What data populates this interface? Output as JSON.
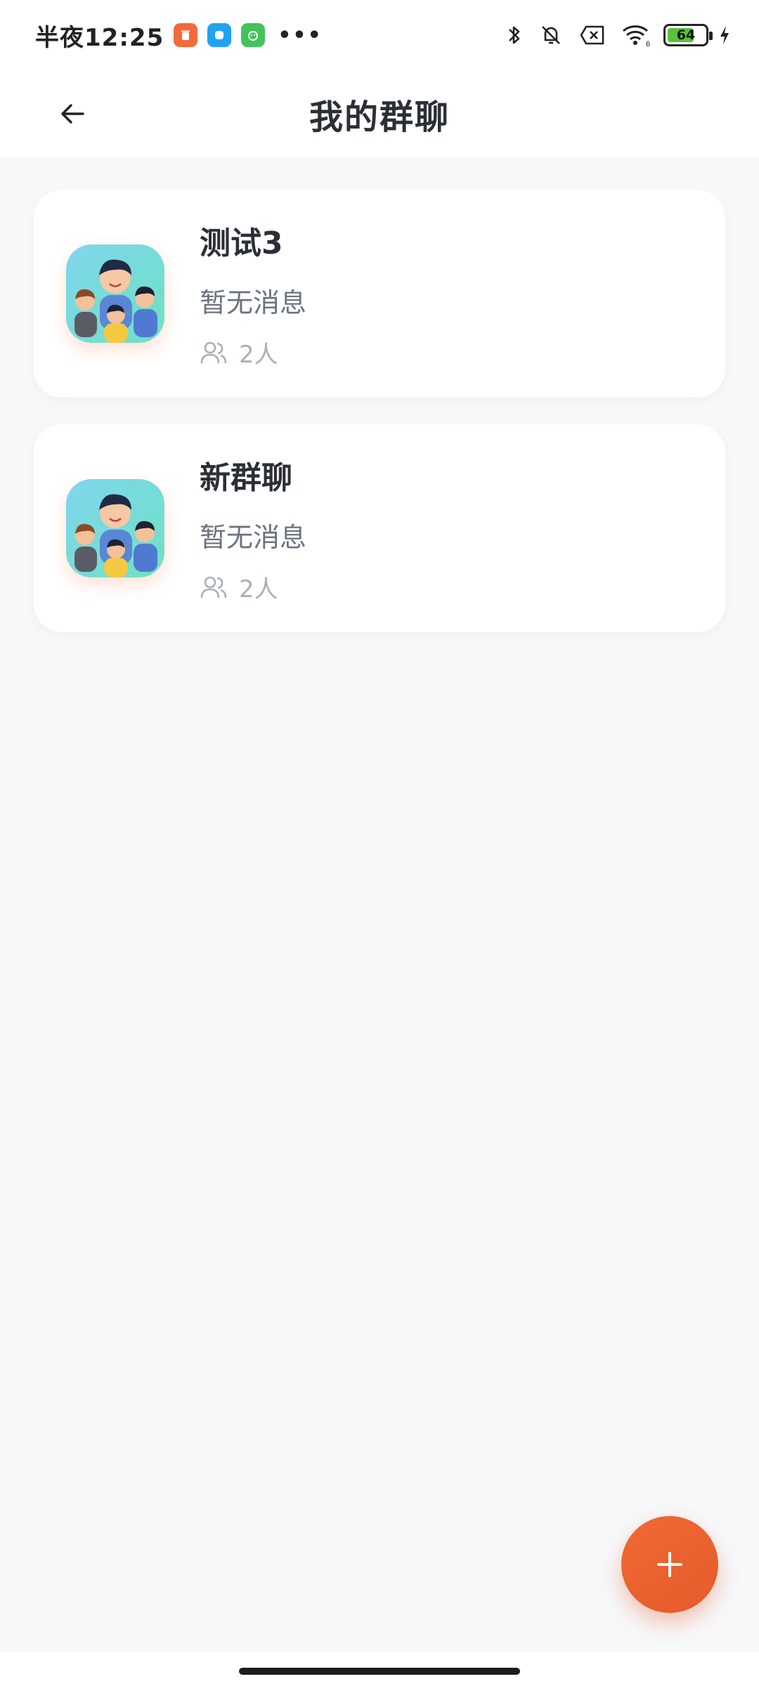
{
  "status_bar": {
    "time": "半夜12:25",
    "more": "•••",
    "battery_level": "64",
    "wifi_label": "6",
    "apps": [
      {
        "name": "trash-app-icon",
        "color": "#f36a3a"
      },
      {
        "name": "blue-app-icon",
        "color": "#1fa3f5"
      },
      {
        "name": "green-app-icon",
        "color": "#41c45a"
      }
    ]
  },
  "header": {
    "title": "我的群聊",
    "back_icon": "arrow-left-icon"
  },
  "groups": [
    {
      "name": "测试3",
      "last_message": "暂无消息",
      "members": "2人",
      "avatar": "family-avatar-icon"
    },
    {
      "name": "新群聊",
      "last_message": "暂无消息",
      "members": "2人",
      "avatar": "family-avatar-icon"
    }
  ],
  "fab": {
    "icon": "plus-icon",
    "color": "#e9602f"
  }
}
